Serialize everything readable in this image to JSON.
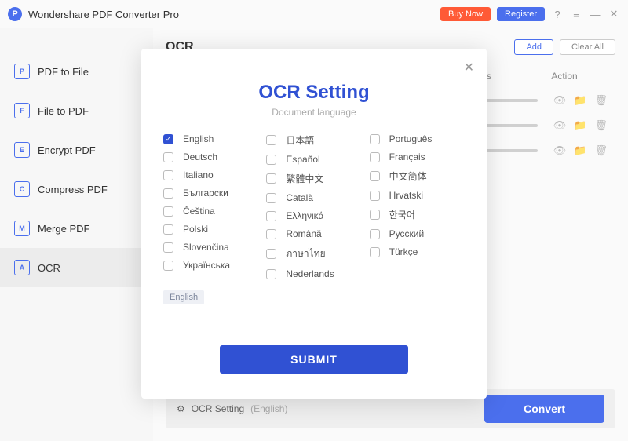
{
  "app": {
    "title": "Wondershare PDF Converter Pro"
  },
  "titlebar": {
    "buy": "Buy Now",
    "register": "Register"
  },
  "sidebar": {
    "items": [
      {
        "label": "PDF to File",
        "icon": "P"
      },
      {
        "label": "File to PDF",
        "icon": "F"
      },
      {
        "label": "Encrypt PDF",
        "icon": "E"
      },
      {
        "label": "Compress PDF",
        "icon": "C"
      },
      {
        "label": "Merge PDF",
        "icon": "M"
      },
      {
        "label": "OCR",
        "icon": "A"
      }
    ]
  },
  "content": {
    "title": "OCR",
    "add": "Add",
    "clear": "Clear All",
    "cols": {
      "status": "Status",
      "action": "Action"
    }
  },
  "footer": {
    "setting": "OCR Setting",
    "lang": "(English)",
    "convert": "Convert"
  },
  "modal": {
    "title": "OCR Setting",
    "subtitle": "Document language",
    "submit": "SUBMIT",
    "selected": "English",
    "col1": [
      "English",
      "Deutsch",
      "Italiano",
      "Български",
      "Čeština",
      "Polski",
      "Slovenčina",
      "Українська"
    ],
    "col2": [
      "日本語",
      "Español",
      "繁體中文",
      "Català",
      "Ελληνικά",
      "Română",
      "ภาษาไทย",
      "Nederlands"
    ],
    "col3": [
      "Português",
      "Français",
      "中文简体",
      "Hrvatski",
      "한국어",
      "Русский",
      "Türkçe"
    ]
  }
}
